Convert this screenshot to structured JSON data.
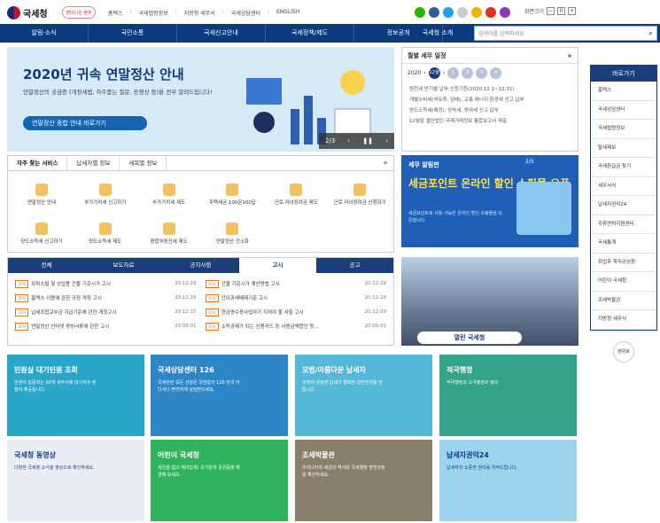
{
  "header": {
    "logo": "국세청",
    "badge": "벤더나은 정부",
    "links": [
      "홈택스",
      "국세법령정보",
      "지방청·세무서",
      "국세상담센터",
      "ENGLISH"
    ],
    "zoom_label": "화면크기"
  },
  "nav": {
    "items": [
      "알림·소식",
      "국민소통",
      "국세신고안내",
      "국세정책/제도",
      "정보공개",
      "국세청 소개"
    ],
    "search_placeholder": "검색어를 입력하세요"
  },
  "banner": {
    "title": "2020년 귀속 연말정산 안내",
    "desc": "연말정산의 궁금증 (개정세법, 자주묻는 질문, 동영상 등)을 전부 알려드립니다!",
    "button": "연말정산 종합 안내 바로가기",
    "page": "2/3"
  },
  "schedule": {
    "title": "월별 세무 일정",
    "year": "2020",
    "months": [
      "12월",
      "1",
      "2",
      "3",
      "4"
    ],
    "items": [
      "원천세 반기별 납부 신청기한(2020.12.1~12.31)",
      "개별소비세(석유류, 담배), 교통·에너지·환경세 신고 납부",
      "양도소득세(예정), 상속세, 증여세 신고 납부",
      "12월말 결산법인 국제거래정보 통합보고서 제출"
    ]
  },
  "quick": {
    "title": "바로가기",
    "items": [
      "홈택스",
      "국세상담센터",
      "국세법령정보",
      "탈세제보",
      "국세환급금 찾기",
      "세무서식",
      "납세자권익24",
      "주류면허지원센터",
      "국세통계",
      "취업후 학자금상환",
      "어린이 국세청",
      "조세박물관",
      "지방청·세무서"
    ],
    "top": "맨위로"
  },
  "services": {
    "tabs": [
      "자주 찾는 서비스",
      "납세자별 정보",
      "세목별 정보"
    ],
    "items": [
      "연말정산 안내",
      "부가가치세 신고하기",
      "부가가치세 제도",
      "주택세금 100문100답",
      "근로·자녀장려금 제도",
      "근로·자녀장려금 신청하기",
      "양도소득세 신고하기",
      "양도소득세 제도",
      "종합부동산세 제도",
      "연말정산 간소화"
    ]
  },
  "alimpan": {
    "title": "세무 알림판",
    "headline": "세금포인트 온라인 할인 쇼핑몰 오픈",
    "desc": "세금포인트로 사용 가능한 온라인 할인 쇼핑몰을 오픈합니다.",
    "page": "2/5"
  },
  "notice": {
    "tabs": [
      "전체",
      "보도자료",
      "공지사항",
      "고시",
      "공고"
    ],
    "rows": [
      [
        "고시",
        "모피스털 및 상업용 건물 기준시가 고시",
        "20.12.29"
      ],
      [
        "고시",
        "건물 기준시가 계산방법 고시",
        "20.12.29"
      ],
      [
        "고시",
        "홈택스 이용에 관한 규정 개정 고시",
        "20.12.29"
      ],
      [
        "고시",
        "간이과세배제기준 고시",
        "20.12.29"
      ],
      [
        "고시",
        "납세조합교부금 지급기준에 관한 개정고시",
        "20.12.15"
      ],
      [
        "고시",
        "현금영수증사업자가 지켜야 할 사항 고시",
        "20.12.09"
      ],
      [
        "고시",
        "연말정산 인터넷 증빙서류에 관한 고시",
        "20.09.01"
      ],
      [
        "고시",
        "소득공제가 되는 신용카드 등 사용금액합인 등...",
        "20.09.01"
      ]
    ]
  },
  "building": {
    "label": "열린 국세청"
  },
  "cards": [
    {
      "title": "민원실 대기인원 조회",
      "desc": "민원이 집중되는 50개 세무서에 대기자수 현황이 제공됩니다.",
      "color": "#2aa6c9"
    },
    {
      "title": "국세상담센터 126",
      "desc": "국세관련 모든 상담은 국번없이 126 전국 어디서나 편리하게 상담받으세요.",
      "color": "#2c86c8"
    },
    {
      "title": "모범/아름다운 납세자",
      "desc": "귀하의 성실한 납세가 행복한 대한민국을 만듭니다.",
      "color": "#54b9d9"
    },
    {
      "title": "적극행정",
      "desc": "적극행정과 소극행정의 정의",
      "color": "#33a38a"
    },
    {
      "title": "국세청 동영상",
      "desc": "다양한 국세청 소식을 영상으로 확인하세요.",
      "color": "#e8eef4"
    },
    {
      "title": "어린이 국세청",
      "desc": "세금을 쉽고 재미있게! 초기일과 궁금증을 해결해 보세요.",
      "color": "#2fb35e"
    },
    {
      "title": "조세박물관",
      "desc": "우리나라의 세금의 역사와 국세행정 발전과정을 확인하세요.",
      "color": "#8a7e6c"
    },
    {
      "title": "납세자권익24",
      "desc": "납세자의 소중한 권리를 지켜드립니다.",
      "color": "#9cd4f0"
    }
  ]
}
